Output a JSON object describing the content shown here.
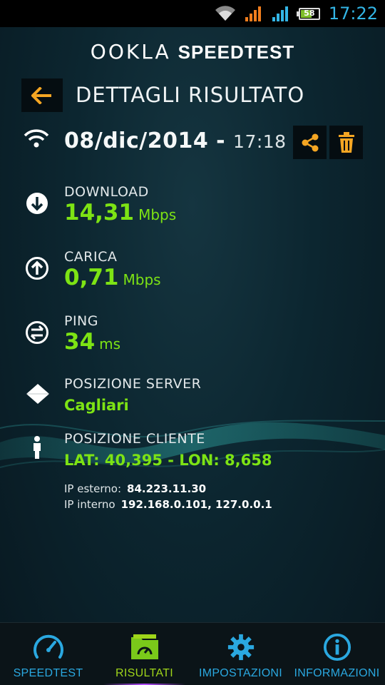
{
  "status_bar": {
    "time": "17:22",
    "battery": "58"
  },
  "header": {
    "logo_left": "OOKLA",
    "logo_right": "SPEEDTEST",
    "title": "DETTAGLI RISULTATO"
  },
  "result": {
    "date": "08/dic/2014 - ",
    "time": "17:18",
    "download": {
      "label": "DOWNLOAD",
      "value": "14,31",
      "unit": "Mbps"
    },
    "upload": {
      "label": "CARICA",
      "value": "0,71",
      "unit": "Mbps"
    },
    "ping": {
      "label": "PING",
      "value": "34",
      "unit": "ms"
    },
    "server": {
      "label": "POSIZIONE SERVER",
      "value": "Cagliari"
    },
    "client": {
      "label": "POSIZIONE CLIENTE",
      "value": "LAT: 40,395 - LON: 8,658"
    },
    "ip_external": {
      "label": "IP esterno:",
      "value": "84.223.11.30"
    },
    "ip_internal": {
      "label": "IP interno",
      "value": "192.168.0.101, 127.0.0.1"
    }
  },
  "nav": [
    {
      "label": "SPEEDTEST",
      "icon": "speedometer-icon"
    },
    {
      "label": "RISULTATI",
      "icon": "results-folder-icon"
    },
    {
      "label": "IMPOSTAZIONI",
      "icon": "gear-icon"
    },
    {
      "label": "INFORMAZIONI",
      "icon": "info-icon"
    }
  ],
  "colors": {
    "accent_green": "#7de314",
    "accent_blue": "#2aa8e0",
    "accent_orange": "#f5a623"
  }
}
